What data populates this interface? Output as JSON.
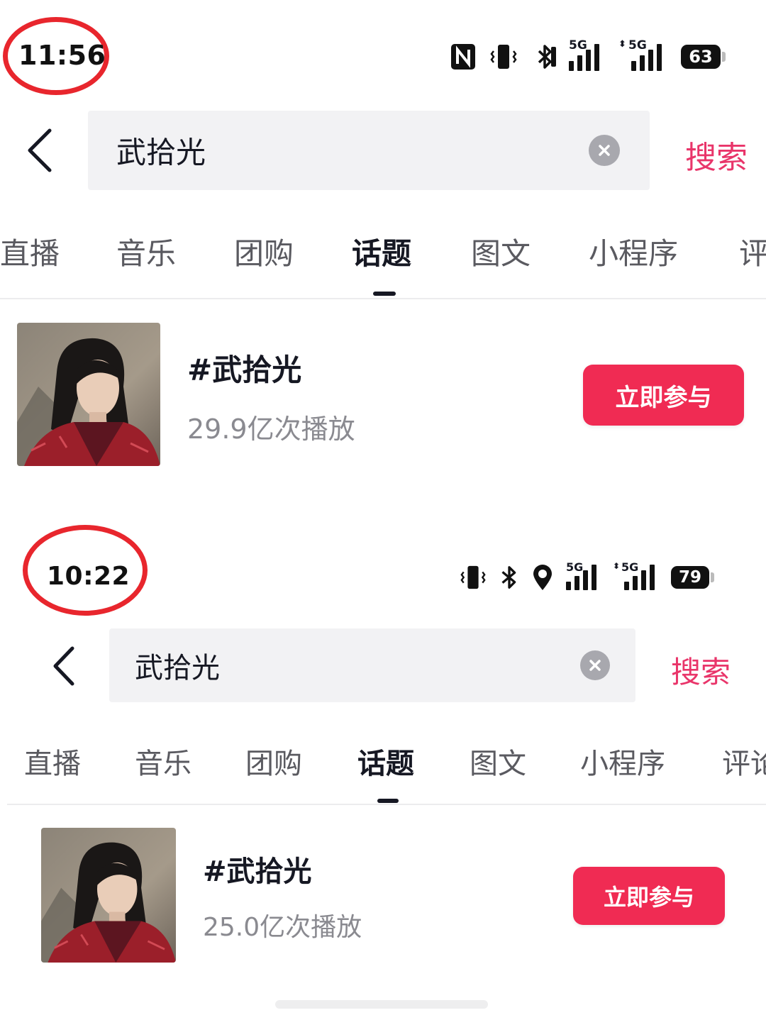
{
  "colors": {
    "accent": "#f02b53",
    "search_text": "#e9356a",
    "annotation_circle": "#e8262d"
  },
  "screenshots": [
    {
      "status_bar": {
        "time": "11:56",
        "signal_label": "5G",
        "battery": "63"
      },
      "search": {
        "query": "武拾光",
        "button": "搜索"
      },
      "tabs": [
        "直播",
        "音乐",
        "团购",
        "话题",
        "图文",
        "小程序",
        "评"
      ],
      "active_tab": "话题",
      "topic": {
        "title": "#武拾光",
        "plays": "29.9亿次播放",
        "join": "立即参与"
      }
    },
    {
      "status_bar": {
        "time": "10:22",
        "signal_label": "5G",
        "battery": "79"
      },
      "search": {
        "query": "武拾光",
        "button": "搜索"
      },
      "tabs": [
        "直播",
        "音乐",
        "团购",
        "话题",
        "图文",
        "小程序",
        "评论"
      ],
      "active_tab": "话题",
      "topic": {
        "title": "#武拾光",
        "plays": "25.0亿次播放",
        "join": "立即参与"
      }
    }
  ]
}
